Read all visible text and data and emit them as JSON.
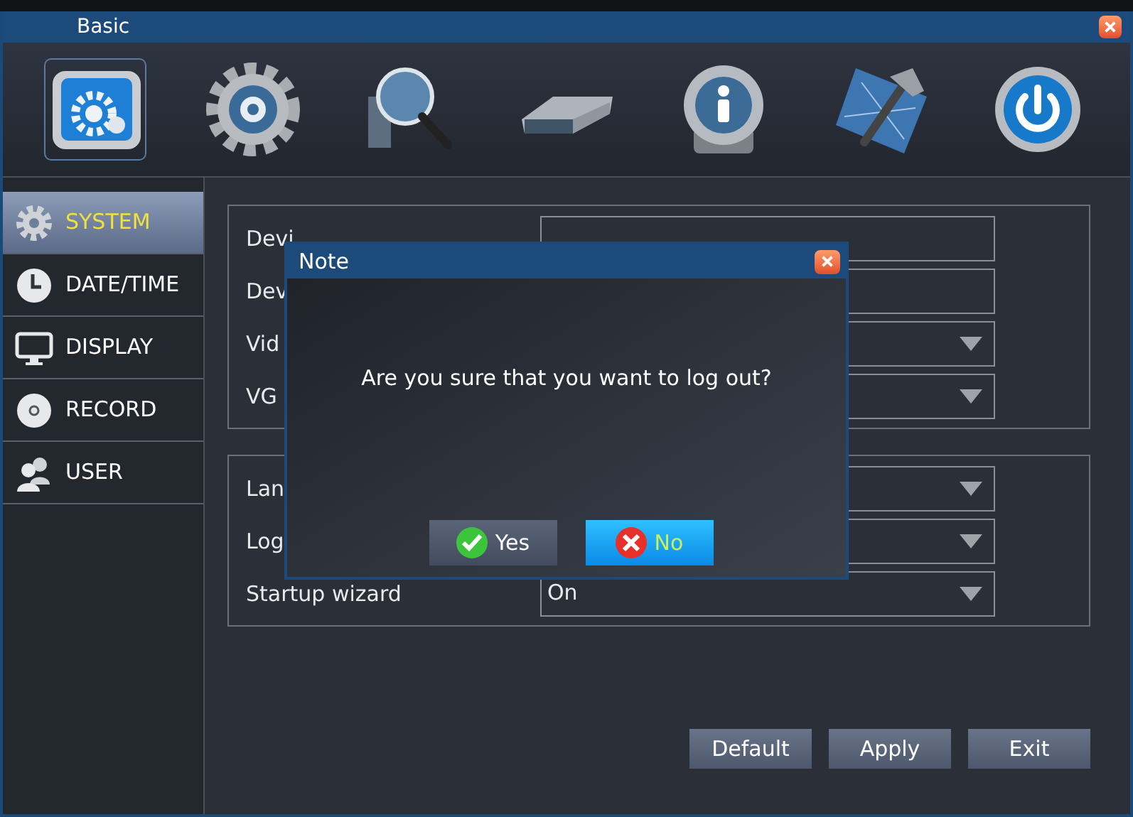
{
  "window": {
    "title": "Basic"
  },
  "toolbar": [
    {
      "kind": "system",
      "selected": true
    },
    {
      "kind": "gear",
      "selected": false
    },
    {
      "kind": "search",
      "selected": false
    },
    {
      "kind": "disk",
      "selected": false
    },
    {
      "kind": "info",
      "selected": false
    },
    {
      "kind": "tools",
      "selected": false
    },
    {
      "kind": "power",
      "selected": false
    }
  ],
  "sidebar": {
    "items": [
      {
        "label": "SYSTEM",
        "selected": true
      },
      {
        "label": "DATE/TIME",
        "selected": false
      },
      {
        "label": "DISPLAY",
        "selected": false
      },
      {
        "label": "RECORD",
        "selected": false
      },
      {
        "label": "USER",
        "selected": false
      }
    ]
  },
  "groups": [
    {
      "rows": [
        {
          "label": "Devi",
          "kind": "text"
        },
        {
          "label": "Dev",
          "kind": "text"
        },
        {
          "label": "Vid",
          "kind": "select"
        },
        {
          "label": "VG",
          "kind": "select"
        }
      ]
    },
    {
      "rows": [
        {
          "label": "Lan",
          "kind": "select"
        },
        {
          "label": "Log",
          "kind": "select"
        },
        {
          "label": "Startup wizard",
          "kind": "select",
          "value": "On"
        }
      ]
    }
  ],
  "buttons": [
    "Default",
    "Apply",
    "Exit"
  ],
  "dialog": {
    "title": "Note",
    "message": "Are you sure that you want to log out?",
    "buttons": [
      {
        "label": "Yes",
        "kind": "yes",
        "selected": false
      },
      {
        "label": "No",
        "kind": "no",
        "selected": true
      }
    ]
  }
}
